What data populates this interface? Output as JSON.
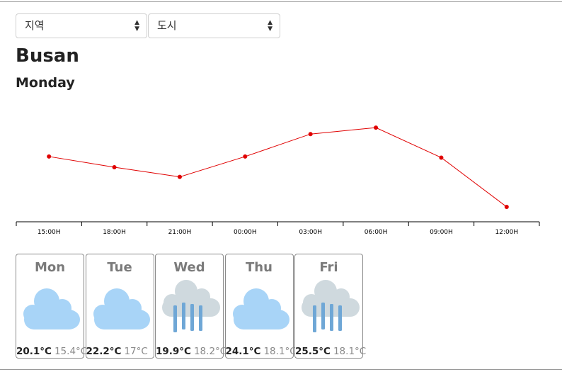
{
  "selectors": {
    "region": {
      "value": "지역"
    },
    "city": {
      "value": "도시"
    }
  },
  "location": {
    "city": "Busan",
    "day": "Monday"
  },
  "chart_data": {
    "type": "line",
    "categories": [
      "15:00H",
      "18:00H",
      "21:00H",
      "00:00H",
      "03:00H",
      "06:00H",
      "09:00H",
      "12:00H"
    ],
    "values": [
      20.1,
      19.1,
      18.2,
      20.1,
      22.2,
      22.8,
      20.0,
      15.4
    ],
    "ylim": [
      15,
      24
    ],
    "color": "#e00000",
    "grid": false
  },
  "forecast": [
    {
      "day": "Mon",
      "icon": "cloud-icon",
      "high": "20.1°C",
      "low": "15.4°C"
    },
    {
      "day": "Tue",
      "icon": "cloud-icon",
      "high": "22.2°C",
      "low": "17°C"
    },
    {
      "day": "Wed",
      "icon": "rain-cloud-icon",
      "high": "19.9°C",
      "low": "18.2°C"
    },
    {
      "day": "Thu",
      "icon": "cloud-icon",
      "high": "24.1°C",
      "low": "18.1°C"
    },
    {
      "day": "Fri",
      "icon": "rain-cloud-icon",
      "high": "25.5°C",
      "low": "18.1°C"
    }
  ]
}
